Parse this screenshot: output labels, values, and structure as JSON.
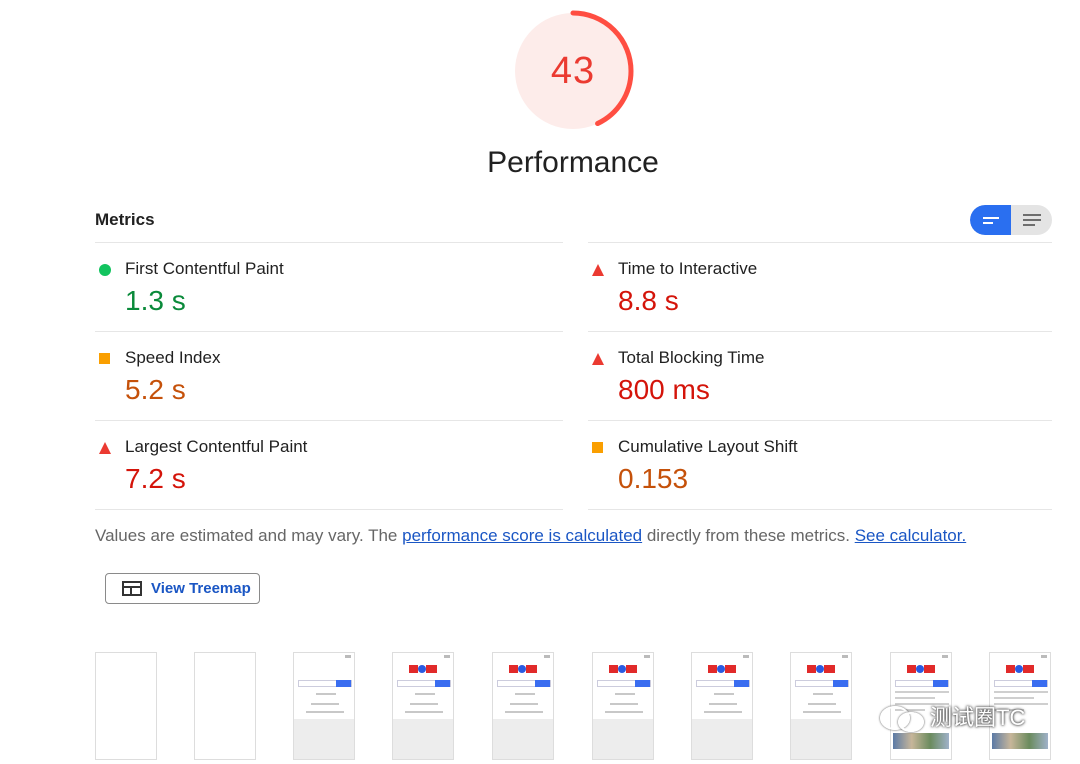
{
  "gauge": {
    "score": "43",
    "score_fraction": 0.43,
    "title": "Performance",
    "color": "#eb3a31"
  },
  "metrics": {
    "title": "Metrics",
    "toggle": {
      "active": "summary-view-icon",
      "inactive": "detail-view-icon"
    },
    "items": [
      {
        "label": "First Contentful Paint",
        "value": "1.3 s",
        "status": "pass",
        "icon": "green-circle-icon"
      },
      {
        "label": "Time to Interactive",
        "value": "8.8 s",
        "status": "fail",
        "icon": "red-triangle-icon"
      },
      {
        "label": "Speed Index",
        "value": "5.2 s",
        "status": "average",
        "icon": "orange-square-icon"
      },
      {
        "label": "Total Blocking Time",
        "value": "800 ms",
        "status": "fail",
        "icon": "red-triangle-icon"
      },
      {
        "label": "Largest Contentful Paint",
        "value": "7.2 s",
        "status": "fail",
        "icon": "red-triangle-icon"
      },
      {
        "label": "Cumulative Layout Shift",
        "value": "0.153",
        "status": "average",
        "icon": "orange-square-icon"
      }
    ]
  },
  "footnote": {
    "text1": "Values are estimated and may vary. The ",
    "link1": "performance score is calculated",
    "text2": " directly from these metrics. ",
    "link2": "See calculator."
  },
  "treemap": {
    "label": "View Treemap",
    "icon": "treemap-icon"
  },
  "filmstrip": {
    "frames": [
      "blank",
      "blank",
      "partial",
      "loaded",
      "loaded",
      "loaded",
      "loaded",
      "loaded",
      "full",
      "full"
    ]
  },
  "watermark": {
    "text": "测试圈TC"
  }
}
